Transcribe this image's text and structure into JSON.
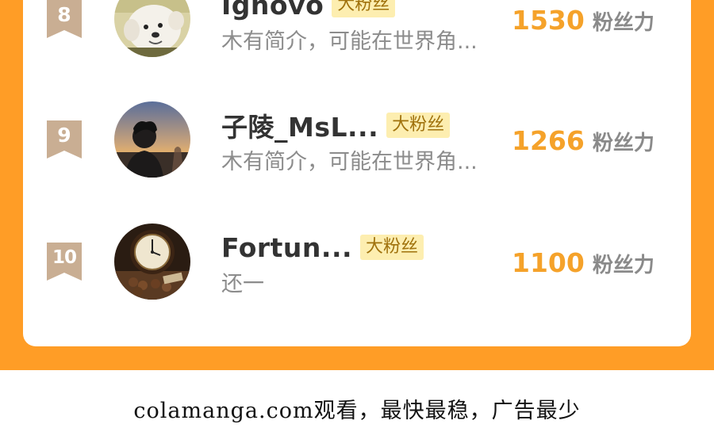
{
  "colors": {
    "frame": "#ff9d26",
    "score": "#f5a22a",
    "badge_bg": "#fdeeb0",
    "rank_badge": "#c9ae93"
  },
  "ranking": [
    {
      "rank": "8",
      "username": "Ignovo",
      "badge": "大粉丝",
      "bio": "木有简介，可能在世界角...",
      "score": "1530",
      "score_unit": "粉丝力",
      "avatar": "dog-photo-avatar"
    },
    {
      "rank": "9",
      "username": "子陵_MsL...",
      "badge": "大粉丝",
      "bio": "木有简介，可能在世界角...",
      "score": "1266",
      "score_unit": "粉丝力",
      "avatar": "sunset-person-avatar"
    },
    {
      "rank": "10",
      "username": "Fortun...",
      "badge": "大粉丝",
      "bio": "还一",
      "score": "1100",
      "score_unit": "粉丝力",
      "avatar": "clock-photo-avatar"
    }
  ],
  "footer": {
    "text": "colamanga.com观看，最快最稳，广告最少"
  }
}
